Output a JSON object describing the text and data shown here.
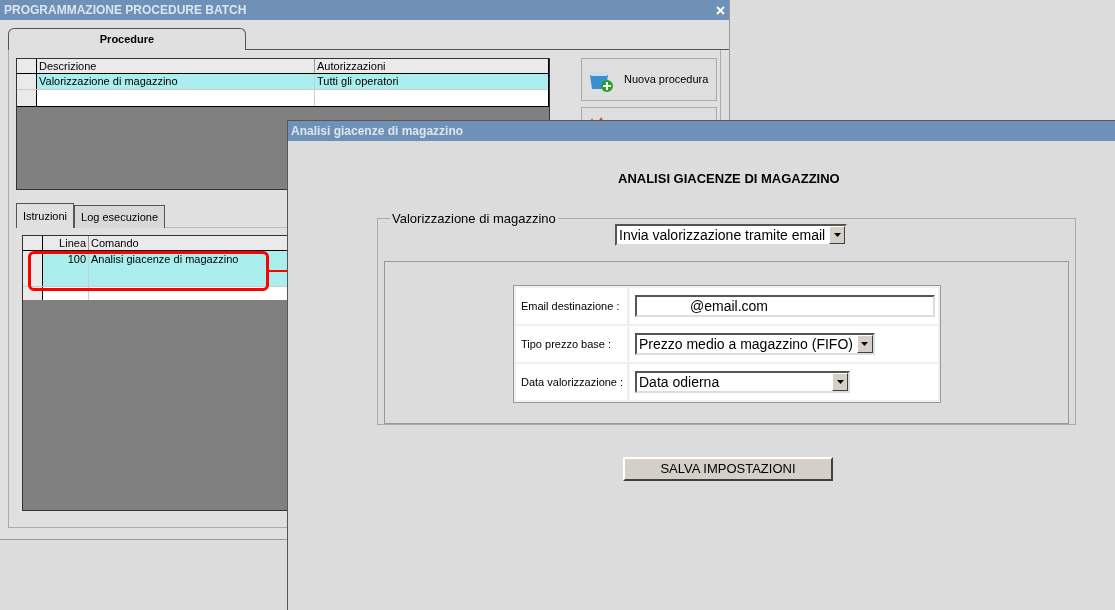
{
  "main_window": {
    "title": "PROGRAMMAZIONE PROCEDURE BATCH",
    "tabs": [
      {
        "label": "Procedure",
        "selected": true
      }
    ],
    "procedures_table": {
      "columns": [
        "Descrizione",
        "Autorizzazioni"
      ],
      "rows": [
        {
          "cells": [
            "Valorizzazione di magazzino",
            "Tutti gli operatori"
          ],
          "selected": true
        }
      ]
    },
    "buttons": [
      {
        "label": "Nuova procedura"
      }
    ],
    "sub_tabs": [
      {
        "label": "Istruzioni",
        "selected": true
      },
      {
        "label": "Log esecuzione",
        "selected": false
      }
    ],
    "instructions_table": {
      "columns": [
        "Linea",
        "Comando"
      ],
      "rows": [
        {
          "cells": [
            "100",
            "Analisi giacenze di magazzino"
          ],
          "selected": true
        }
      ]
    }
  },
  "dialog": {
    "title": "Analisi giacenze di magazzino",
    "heading": "ANALISI GIACENZE DI MAGAZZINO",
    "group_label": "Valorizzazione di magazzino",
    "mode_select": "Invia valorizzazione tramite email",
    "fields": [
      {
        "kind": "text",
        "label": "Email destinazione :",
        "value": "@email.com"
      },
      {
        "kind": "select",
        "label": "Tipo prezzo base :",
        "value": "Prezzo medio a magazzino (FIFO)"
      },
      {
        "kind": "select",
        "label": "Data valorizzazione :",
        "value": "Data odierna"
      }
    ],
    "save_button": "SALVA IMPOSTAZIONI"
  }
}
